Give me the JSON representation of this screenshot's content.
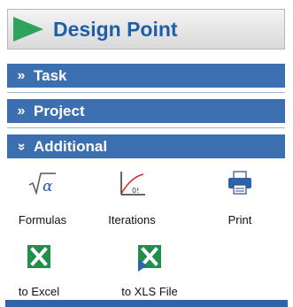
{
  "title": "Design Point",
  "sections": [
    {
      "label": "Task",
      "chevron": "»"
    },
    {
      "label": "Project",
      "chevron": "»"
    },
    {
      "label": "Additional",
      "chevron": "»"
    }
  ],
  "tools": [
    {
      "label": "Formulas",
      "icon": "sqrt-alpha-icon"
    },
    {
      "label": "Iterations",
      "icon": "iterations-icon"
    },
    {
      "label": "Print",
      "icon": "printer-icon"
    },
    {
      "label": "to Excel",
      "icon": "excel-icon"
    },
    {
      "label": "to XLS File",
      "icon": "xls-file-icon"
    }
  ],
  "colors": {
    "title_text": "#1f5fa8",
    "title_arrow": "#2ea35a",
    "section_header": "#3c6fb0",
    "excel_green": "#1f8f4a"
  }
}
